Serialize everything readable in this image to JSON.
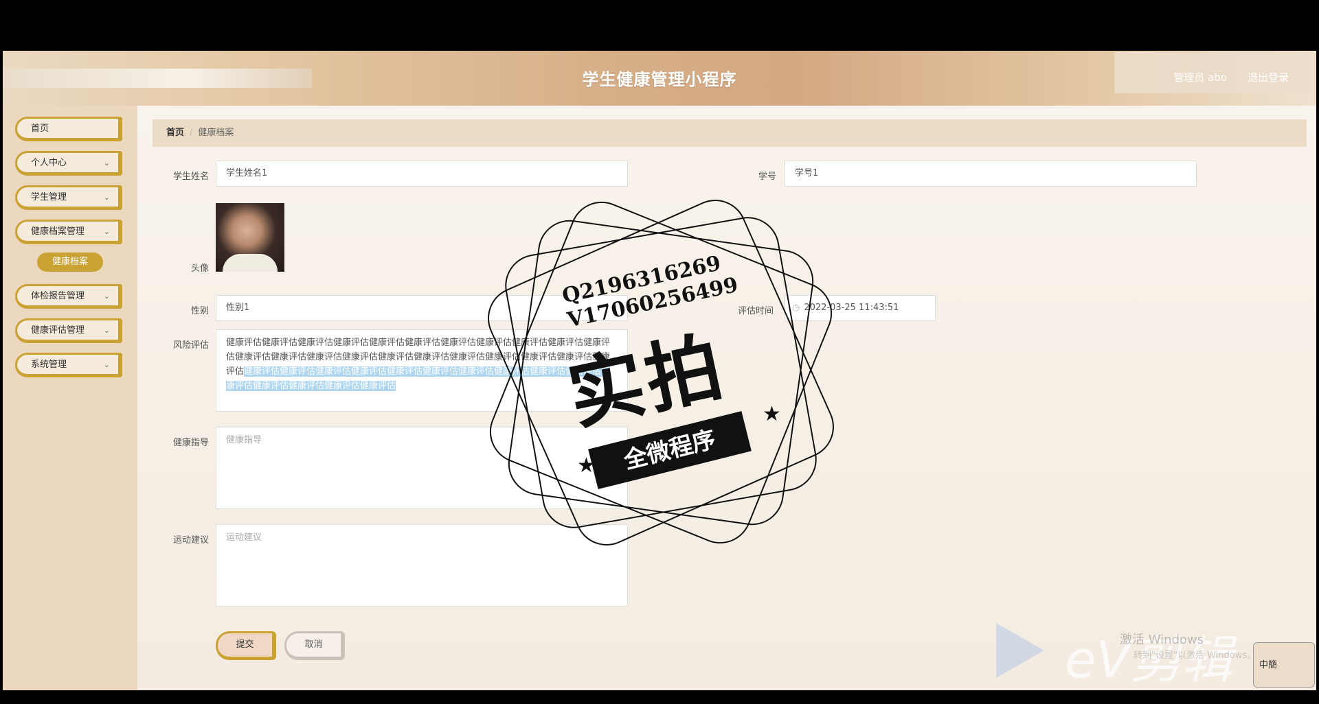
{
  "header": {
    "title": "学生健康管理小程序",
    "user": "管理员 abo",
    "logout": "退出登录"
  },
  "sidebar": {
    "items": [
      {
        "label": "首页",
        "has_chevron": false
      },
      {
        "label": "个人中心",
        "has_chevron": true
      },
      {
        "label": "学生管理",
        "has_chevron": true
      },
      {
        "label": "健康档案管理",
        "has_chevron": true
      },
      {
        "label": "体检报告管理",
        "has_chevron": true
      },
      {
        "label": "健康评估管理",
        "has_chevron": true
      },
      {
        "label": "系统管理",
        "has_chevron": true
      }
    ],
    "active_sub": "健康档案"
  },
  "breadcrumb": {
    "home": "首页",
    "separator": "/",
    "current": "健康档案"
  },
  "form": {
    "student_name_label": "学生姓名",
    "student_name_value": "学生姓名1",
    "student_id_label": "学号",
    "student_id_value": "学号1",
    "avatar_label": "头像",
    "gender_label": "性别",
    "gender_value": "性别1",
    "eval_time_label": "评估时间",
    "eval_time_value": "2022-03-25 11:43:51",
    "risk_label": "风险评估",
    "risk_text_plain": "健康评估健康评估健康评估健康评估健康评估健康评估健康评估健康评估健康评估健康评估健康评估健康评估健康评估健康评估健康评估健康评估健康评估健康评估健康评估健康评估健康评估健康评估",
    "risk_text_selected": "健康评估健康评估健康评估健康评估健康评估健康评估健康评估健康评估健康评估健康评估健康评估健康评估健康评估健康评估健康评估",
    "guide_label": "健康指导",
    "guide_placeholder": "健康指导",
    "exercise_label": "运动建议",
    "exercise_placeholder": "运动建议",
    "submit": "提交",
    "cancel": "取消"
  },
  "stamp": {
    "qq": "Q2196316269",
    "vx": "V17060256499",
    "big_text": "实拍",
    "ribbon_text": "全微程序"
  },
  "watermark": {
    "brand": "eV剪辑",
    "activate_line1": "激活 Windows",
    "activate_line2": "转到\"设置\"以激活 Windows。",
    "ime": "中簡"
  },
  "colors": {
    "accent": "#c9a233",
    "sidebar_bg": "#ecd8bf",
    "header_bg": "#d7b089"
  }
}
